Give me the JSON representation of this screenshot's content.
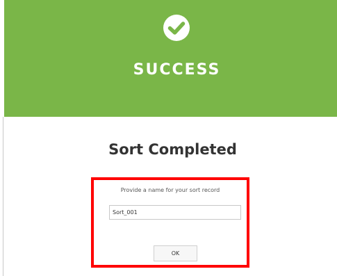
{
  "header": {
    "title": "SUCCESS",
    "icon": "check-circle-icon",
    "background_color": "#7ab648"
  },
  "body": {
    "title": "Sort Completed"
  },
  "form": {
    "prompt": "Provide a name for your sort record",
    "name_value": "Sort_001",
    "ok_label": "OK"
  },
  "annotation": {
    "highlight_color": "#ff0000"
  }
}
